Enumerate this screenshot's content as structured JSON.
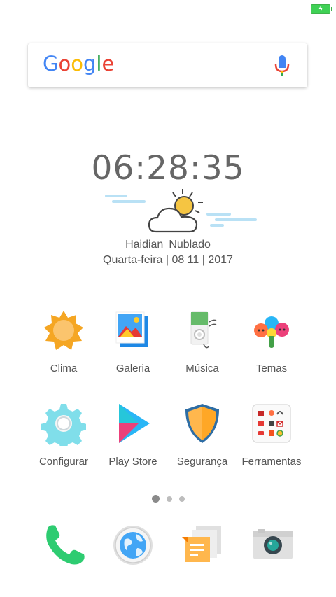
{
  "status_bar": {
    "battery_icon": "battery-charging-icon",
    "battery_color": "#3fd155"
  },
  "search": {
    "logo": "Google",
    "mic_icon": "mic-icon"
  },
  "clock": {
    "time": "06:28:35"
  },
  "weather": {
    "location": "Haidian",
    "condition": "Nublado",
    "date": "Quarta-feira | 08 11 | 2017",
    "icon": "partly-cloudy-icon"
  },
  "apps": [
    {
      "label": "Clima",
      "icon": "sun-icon"
    },
    {
      "label": "Galeria",
      "icon": "gallery-icon"
    },
    {
      "label": "Música",
      "icon": "music-player-icon"
    },
    {
      "label": "Temas",
      "icon": "themes-icon"
    },
    {
      "label": "Configurar",
      "icon": "gear-icon"
    },
    {
      "label": "Play Store",
      "icon": "play-store-icon"
    },
    {
      "label": "Segurança",
      "icon": "shield-icon"
    },
    {
      "label": "Ferramentas",
      "icon": "tools-folder-icon"
    }
  ],
  "page_indicator": {
    "pages": 3,
    "current": 1
  },
  "dock": [
    {
      "name": "phone",
      "icon": "phone-icon"
    },
    {
      "name": "browser",
      "icon": "browser-icon"
    },
    {
      "name": "messages",
      "icon": "messages-icon"
    },
    {
      "name": "camera",
      "icon": "camera-icon"
    }
  ]
}
